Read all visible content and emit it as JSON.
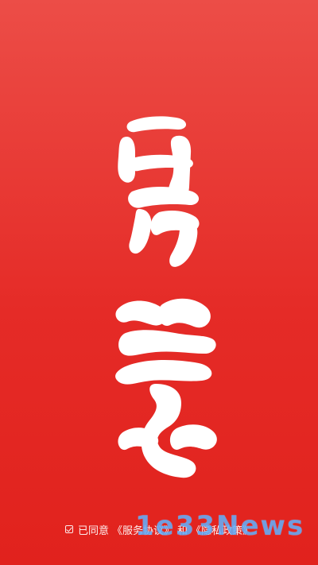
{
  "theme": {
    "background_top": "#ec4d47",
    "background_bottom": "#e1221d",
    "text_color": "#ffffff",
    "watermark_color": "#50aaff"
  },
  "logo": {
    "text": "青學"
  },
  "agreement": {
    "checkbox_icon": "checkbox-checked-icon",
    "prefix": "已同意",
    "service_agreement": "《服务协议》",
    "conjunction": "和",
    "privacy_policy": "《隐私政策》"
  },
  "watermark": {
    "text": "1e33News"
  }
}
